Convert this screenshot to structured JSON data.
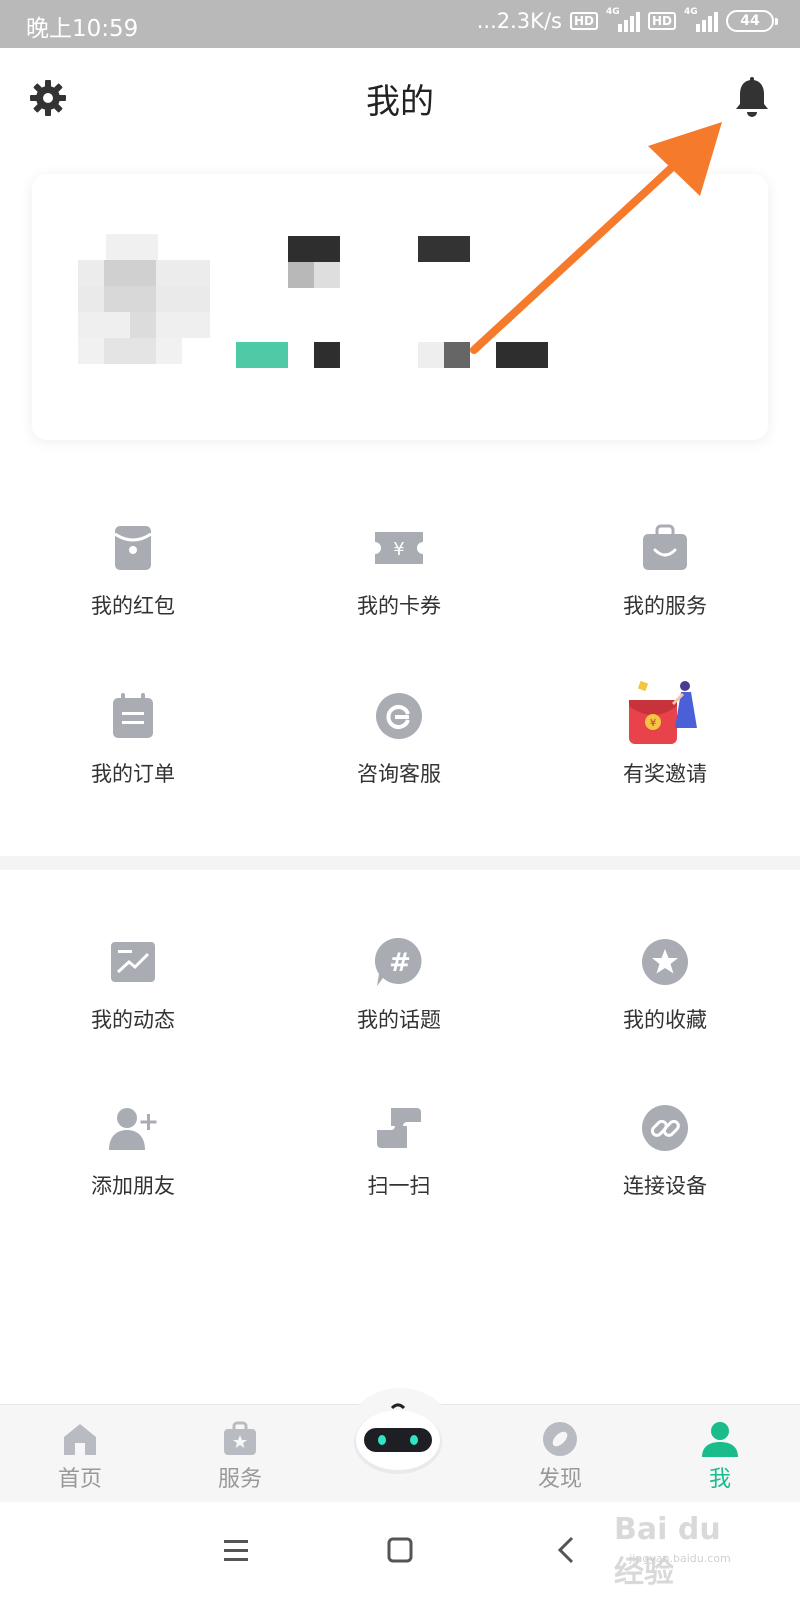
{
  "status_bar": {
    "time": "晚上10:59",
    "network_speed": "...2.3K/s",
    "hd_label": "HD",
    "network_type": "4G",
    "battery": "44"
  },
  "header": {
    "title": "我的",
    "settings_icon": "gear-icon",
    "notification_icon": "bell-icon"
  },
  "profile_card": {
    "avatar": "pixelated-avatar",
    "name": "",
    "info": ""
  },
  "annotation": {
    "arrow_color": "#f57a2b"
  },
  "grid_primary": [
    {
      "label": "我的红包",
      "icon": "red-packet-icon"
    },
    {
      "label": "我的卡券",
      "icon": "coupon-icon"
    },
    {
      "label": "我的服务",
      "icon": "service-bag-icon"
    },
    {
      "label": "我的订单",
      "icon": "order-icon"
    },
    {
      "label": "咨询客服",
      "icon": "customer-service-icon"
    },
    {
      "label": "有奖邀请",
      "icon": "invite-reward-icon"
    }
  ],
  "grid_secondary": [
    {
      "label": "我的动态",
      "icon": "moments-icon"
    },
    {
      "label": "我的话题",
      "icon": "topic-hash-icon"
    },
    {
      "label": "我的收藏",
      "icon": "favorite-star-icon"
    },
    {
      "label": "添加朋友",
      "icon": "add-friend-icon"
    },
    {
      "label": "扫一扫",
      "icon": "scan-icon"
    },
    {
      "label": "连接设备",
      "icon": "link-device-icon"
    }
  ],
  "tab_bar": [
    {
      "label": "首页",
      "icon": "home-icon",
      "active": false
    },
    {
      "label": "服务",
      "icon": "service-icon",
      "active": false
    },
    {
      "label": "",
      "icon": "robot-icon",
      "active": false
    },
    {
      "label": "发现",
      "icon": "discover-icon",
      "active": false
    },
    {
      "label": "我",
      "icon": "profile-icon",
      "active": true
    }
  ],
  "colors": {
    "accent": "#1abc8c",
    "icon_gray": "#a9acb3",
    "status_bar_bg": "#b9b9b9"
  },
  "watermark": {
    "logo": "Bai du 经验",
    "url": "jingyan.baidu.com"
  }
}
